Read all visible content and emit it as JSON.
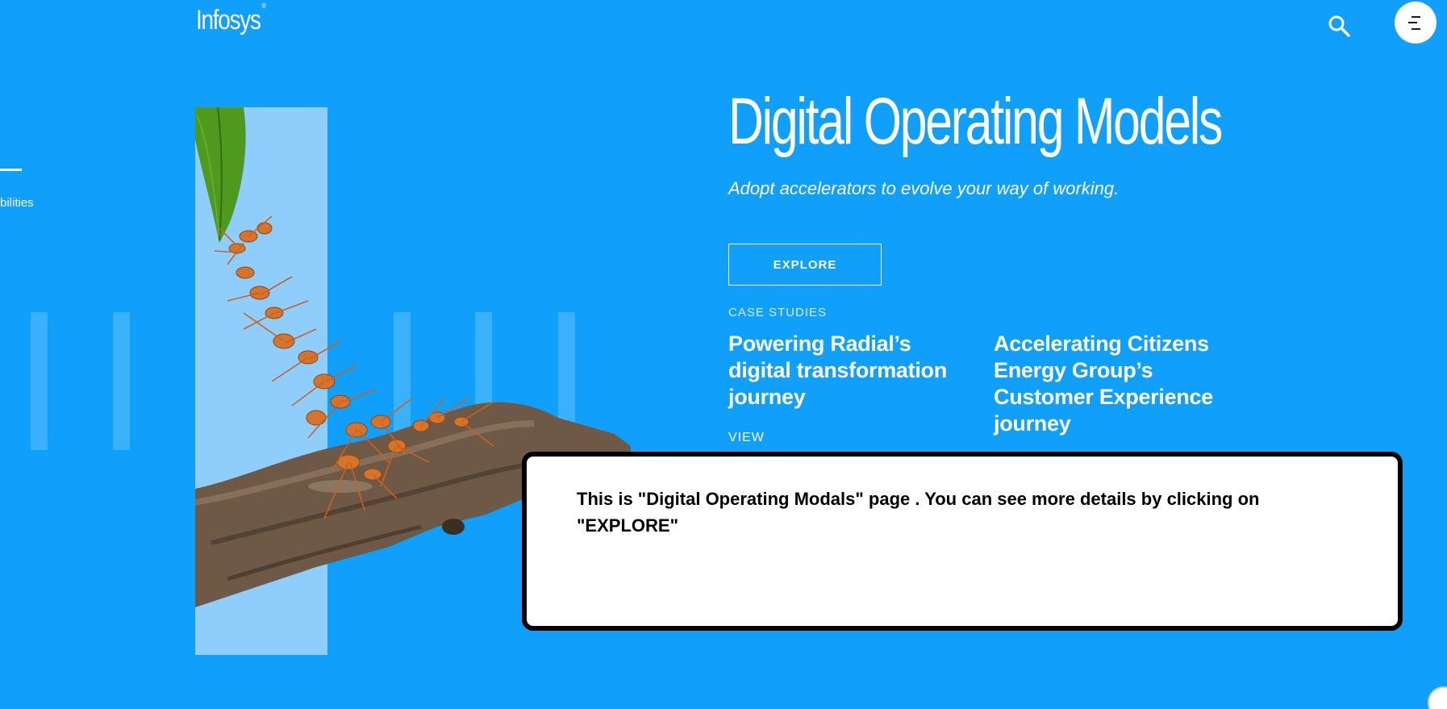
{
  "header": {
    "logo_text": "Infosys",
    "logo_mark": "®",
    "search_icon": "search-icon",
    "menu_icon": "menu-icon"
  },
  "side_nav": {
    "label": "bilities"
  },
  "hero": {
    "title": "Digital Operating Models",
    "subtitle": "Adopt accelerators to evolve your way of working.",
    "explore_label": "EXPLORE",
    "image": "ants-on-branch-image"
  },
  "case_studies": {
    "label": "CASE STUDIES",
    "items": [
      {
        "title": "Powering Radial’s digital transformation journey"
      },
      {
        "title": "Accelerating Citizens Energy Group’s Customer Experience journey"
      }
    ],
    "view_label": "VIEW"
  },
  "callout": {
    "text": "This is \"Digital Operating Modals\" page . You can see more details by clicking on \"EXPLORE\""
  },
  "colors": {
    "background": "#109ffb",
    "panel": "#8ecdfc",
    "text": "#ffffff"
  }
}
